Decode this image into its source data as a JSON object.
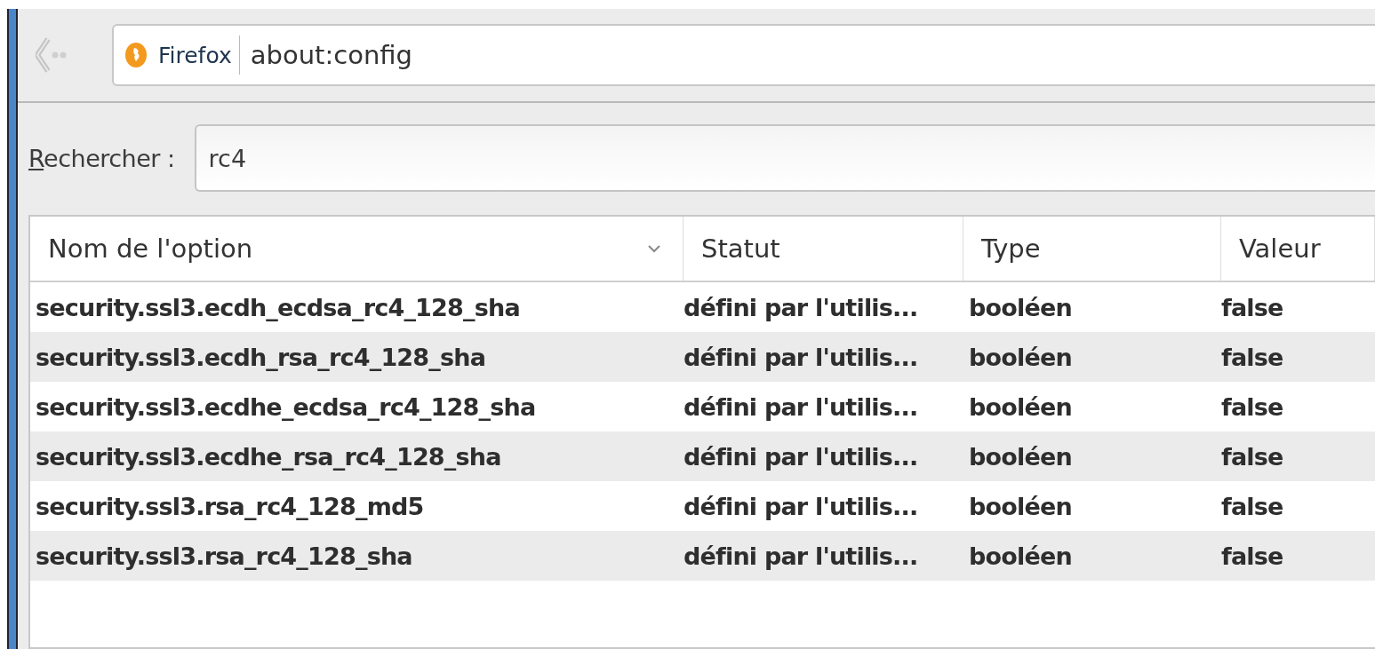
{
  "address_bar": {
    "identity": "Firefox",
    "url": "about:config"
  },
  "search": {
    "label": "Rechercher :",
    "value": "rc4"
  },
  "table": {
    "columns": [
      {
        "label": "Nom de l'option",
        "sorted": true
      },
      {
        "label": "Statut",
        "sorted": false
      },
      {
        "label": "Type",
        "sorted": false
      },
      {
        "label": "Valeur",
        "sorted": false
      }
    ],
    "rows": [
      {
        "name": "security.ssl3.ecdh_ecdsa_rc4_128_sha",
        "status": "défini par l'utilis...",
        "type": "booléen",
        "value": "false",
        "modified": true
      },
      {
        "name": "security.ssl3.ecdh_rsa_rc4_128_sha",
        "status": "défini par l'utilis...",
        "type": "booléen",
        "value": "false",
        "modified": true
      },
      {
        "name": "security.ssl3.ecdhe_ecdsa_rc4_128_sha",
        "status": "défini par l'utilis...",
        "type": "booléen",
        "value": "false",
        "modified": true
      },
      {
        "name": "security.ssl3.ecdhe_rsa_rc4_128_sha",
        "status": "défini par l'utilis...",
        "type": "booléen",
        "value": "false",
        "modified": true
      },
      {
        "name": "security.ssl3.rsa_rc4_128_md5",
        "status": "défini par l'utilis...",
        "type": "booléen",
        "value": "false",
        "modified": true
      },
      {
        "name": "security.ssl3.rsa_rc4_128_sha",
        "status": "défini par l'utilis...",
        "type": "booléen",
        "value": "false",
        "modified": true
      }
    ]
  }
}
